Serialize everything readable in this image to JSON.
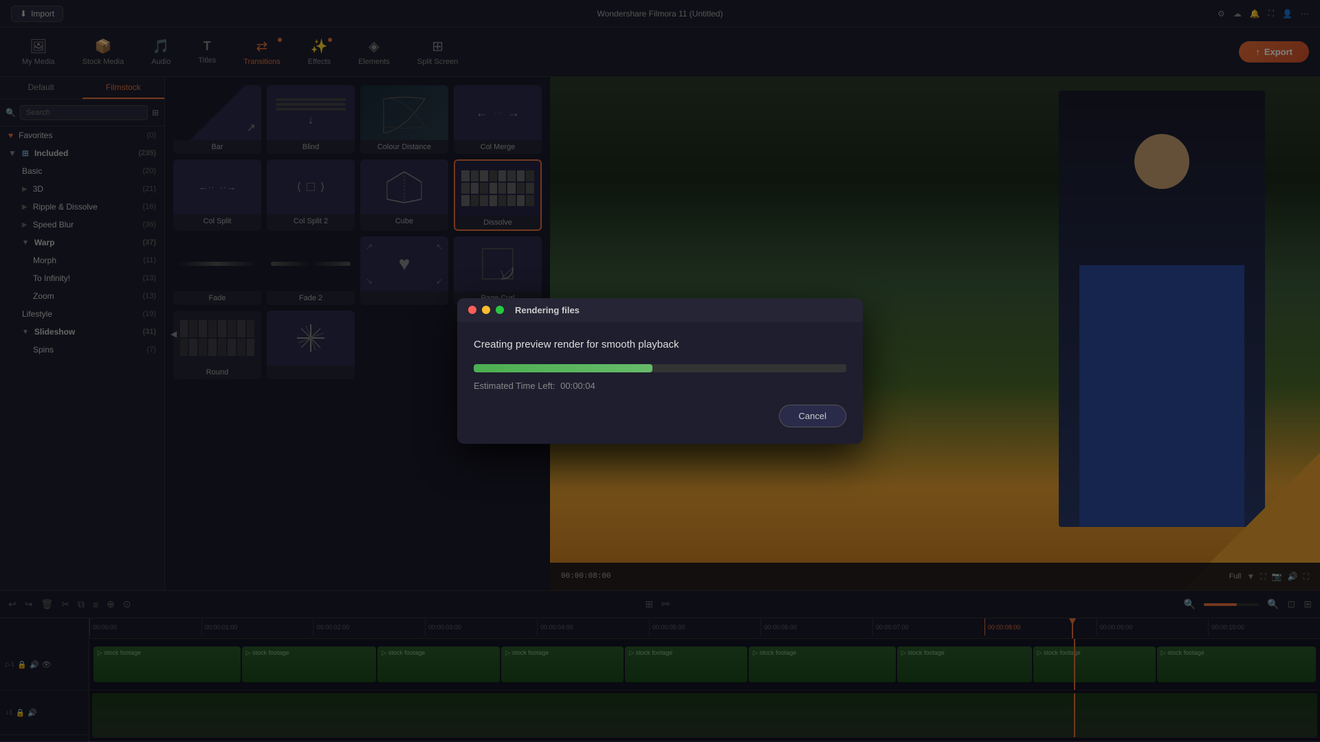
{
  "app": {
    "title": "Wondershare Filmora 11 (Untitled)",
    "window_controls": [
      "●",
      "○",
      "○"
    ]
  },
  "titlebar": {
    "import_label": "Import",
    "settings_icon": "⚙",
    "cloud_icon": "☁",
    "bell_icon": "🔔",
    "screen_icon": "⛶",
    "person_icon": "👤",
    "more_icon": "⋯"
  },
  "toolbar": {
    "items": [
      {
        "id": "my-media",
        "icon": "🖼",
        "label": "My Media",
        "active": false,
        "dot": false
      },
      {
        "id": "stock-media",
        "icon": "📦",
        "label": "Stock Media",
        "active": false,
        "dot": false
      },
      {
        "id": "audio",
        "icon": "🎵",
        "label": "Audio",
        "active": false,
        "dot": false
      },
      {
        "id": "titles",
        "icon": "T",
        "label": "Titles",
        "active": false,
        "dot": false
      },
      {
        "id": "transitions",
        "icon": "▷◁",
        "label": "Transitions",
        "active": true,
        "dot": true
      },
      {
        "id": "effects",
        "icon": "✨",
        "label": "Effects",
        "active": false,
        "dot": true
      },
      {
        "id": "elements",
        "icon": "◈",
        "label": "Elements",
        "active": false,
        "dot": false
      },
      {
        "id": "split-screen",
        "icon": "⊞",
        "label": "Split Screen",
        "active": false,
        "dot": false
      }
    ],
    "export_label": "Export",
    "export_icon": "↑"
  },
  "sidebar": {
    "tabs": [
      {
        "id": "default",
        "label": "Default",
        "active": false
      },
      {
        "id": "filmstock",
        "label": "Filmstock",
        "active": true
      }
    ],
    "search_placeholder": "Search",
    "items": [
      {
        "id": "favorites",
        "icon": "♥",
        "label": "Favorites",
        "count": "(0)",
        "level": 0,
        "expanded": false,
        "has_icon": true
      },
      {
        "id": "included",
        "icon": "⊞",
        "label": "Included",
        "count": "(235)",
        "level": 0,
        "expanded": true
      },
      {
        "id": "basic",
        "label": "Basic",
        "count": "(20)",
        "level": 1
      },
      {
        "id": "3d",
        "label": "3D",
        "count": "(21)",
        "level": 1,
        "has_arrow": true
      },
      {
        "id": "ripple",
        "label": "Ripple & Dissolve",
        "count": "(16)",
        "level": 1,
        "has_arrow": true
      },
      {
        "id": "speed-blur",
        "label": "Speed Blur",
        "count": "(36)",
        "level": 1,
        "has_arrow": true
      },
      {
        "id": "warp",
        "label": "Warp",
        "count": "(37)",
        "level": 1,
        "expanded": true
      },
      {
        "id": "morph",
        "label": "Morph",
        "count": "(11)",
        "level": 2
      },
      {
        "id": "to-infinity",
        "label": "To Infinity!",
        "count": "(13)",
        "level": 2
      },
      {
        "id": "zoom",
        "label": "Zoom",
        "count": "(13)",
        "level": 2
      },
      {
        "id": "lifestyle",
        "label": "Lifestyle",
        "count": "(19)",
        "level": 1
      },
      {
        "id": "slideshow",
        "label": "Slideshow",
        "count": "(31)",
        "level": 1,
        "expanded": true
      },
      {
        "id": "spins",
        "label": "Spins",
        "count": "(7)",
        "level": 2
      }
    ]
  },
  "transitions": {
    "cards": [
      {
        "id": "bar",
        "label": "Bar",
        "type": "bar",
        "selected": false
      },
      {
        "id": "blind",
        "label": "Blind",
        "type": "blind",
        "selected": false
      },
      {
        "id": "colour-distance",
        "label": "Colour Distance",
        "type": "colour-distance",
        "selected": false
      },
      {
        "id": "col-merge",
        "label": "Col Merge",
        "type": "col-merge",
        "selected": false
      },
      {
        "id": "col-split",
        "label": "Col Split",
        "type": "col-split",
        "selected": false
      },
      {
        "id": "col-split-2",
        "label": "Col Split 2",
        "type": "col-split-2",
        "selected": false
      },
      {
        "id": "cube",
        "label": "Cube",
        "type": "cube",
        "selected": false
      },
      {
        "id": "dissolve",
        "label": "Dissolve",
        "type": "dissolve",
        "selected": true
      },
      {
        "id": "fade",
        "label": "Fade",
        "type": "fade",
        "selected": false
      },
      {
        "id": "fade-2",
        "label": "Fade 2",
        "type": "fade-2",
        "selected": false
      },
      {
        "id": "heart",
        "label": "",
        "type": "heart",
        "selected": false
      },
      {
        "id": "page-curl",
        "label": "Page Curl",
        "type": "page-curl",
        "selected": false
      },
      {
        "id": "round",
        "label": "Round",
        "type": "round",
        "selected": false
      },
      {
        "id": "star-burst",
        "label": "",
        "type": "star-burst",
        "selected": false
      }
    ]
  },
  "render_dialog": {
    "title": "Rendering files",
    "dots": [
      "red",
      "yellow",
      "green"
    ],
    "message": "Creating preview render for smooth playback",
    "progress_percent": 48,
    "time_left_label": "Estimated Time Left:",
    "time_left_value": "00:00:04",
    "cancel_label": "Cancel"
  },
  "preview": {
    "playback_time": "00:00:08:00",
    "quality": "Full"
  },
  "timeline": {
    "time_marks": [
      "00:00:00",
      "00:00:01:00",
      "00:00:02:00",
      "00:00:03:00",
      "00:00:04:00",
      "00:00:05:00",
      "00:00:06:00",
      "00:00:07:00",
      "00:00:08:00",
      "00:00:09:00",
      "00:00:10:00"
    ],
    "tracks": [
      {
        "id": "video-1",
        "icons": [
          "▷",
          "🔒",
          "🔊",
          "👁"
        ],
        "label": "1"
      },
      {
        "id": "audio-1",
        "icons": [
          "♪",
          "🔒",
          "🔊"
        ],
        "label": "1"
      }
    ],
    "clips": [
      {
        "label": "stock footage"
      },
      {
        "label": "stock footage"
      },
      {
        "label": "stock footage"
      },
      {
        "label": "stock footage"
      },
      {
        "label": "stock footage"
      },
      {
        "label": "stock footage"
      },
      {
        "label": "stock footage"
      },
      {
        "label": "stock footage"
      },
      {
        "label": "stock footage"
      }
    ]
  }
}
